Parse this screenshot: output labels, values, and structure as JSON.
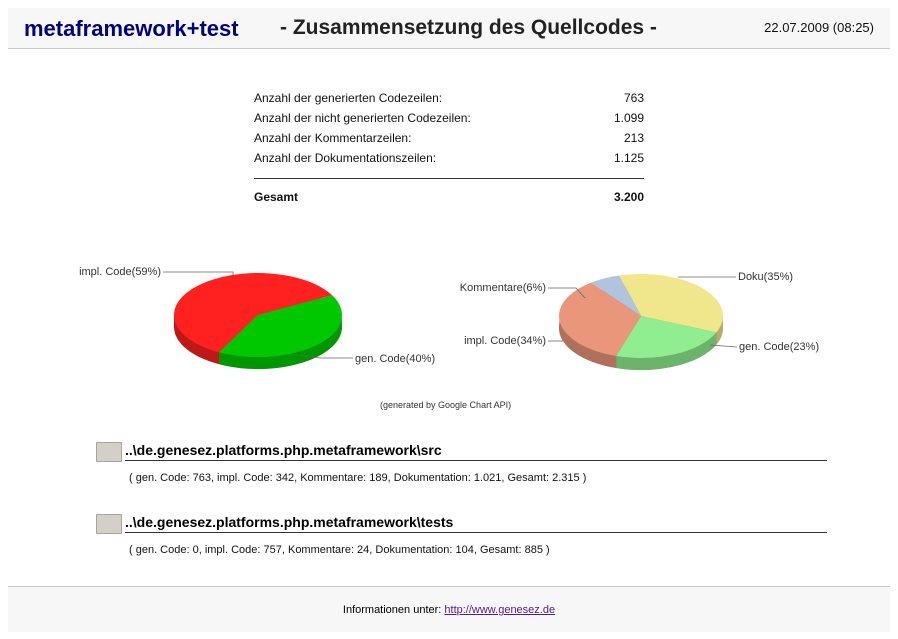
{
  "header": {
    "brand": "metaframework+test",
    "title": "- Zusammensetzung des Quellcodes -",
    "timestamp": "22.07.2009 (08:25)"
  },
  "stats": {
    "rows": [
      {
        "label": "Anzahl der generierten Codezeilen:",
        "value": "763"
      },
      {
        "label": "Anzahl der nicht generierten Codezeilen:",
        "value": "1.099"
      },
      {
        "label": "Anzahl der Kommentarzeilen:",
        "value": "213"
      },
      {
        "label": "Anzahl der Dokumentationszeilen:",
        "value": "1.125"
      }
    ],
    "total_label": "Gesamt",
    "total_value": "3.200"
  },
  "chart_data": [
    {
      "type": "pie",
      "title": "",
      "categories": [
        "impl. Code(59%)",
        "gen. Code(40%)"
      ],
      "values": [
        59,
        40
      ],
      "colors": [
        "#ff2020",
        "#00c800"
      ]
    },
    {
      "type": "pie",
      "title": "",
      "categories": [
        "Doku(35%)",
        "gen. Code(23%)",
        "impl. Code(34%)",
        "Kommentare(6%)"
      ],
      "values": [
        35,
        23,
        34,
        6
      ],
      "colors": [
        "#f0e68c",
        "#90ee90",
        "#e9967a",
        "#b0c4de"
      ]
    }
  ],
  "generated_note": "(generated by Google Chart API)",
  "modules": [
    {
      "path": "..\\de.genesez.platforms.php.metaframework\\src",
      "detail": "( gen. Code: 763, impl. Code: 342, Kommentare: 189, Dokumentation: 1.021, Gesamt: 2.315 )"
    },
    {
      "path": "..\\de.genesez.platforms.php.metaframework\\tests",
      "detail": "( gen. Code: 0, impl. Code: 757, Kommentare: 24, Dokumentation: 104, Gesamt: 885 )"
    }
  ],
  "footer": {
    "text": "Informationen unter:",
    "link": "http://www.genesez.de"
  }
}
